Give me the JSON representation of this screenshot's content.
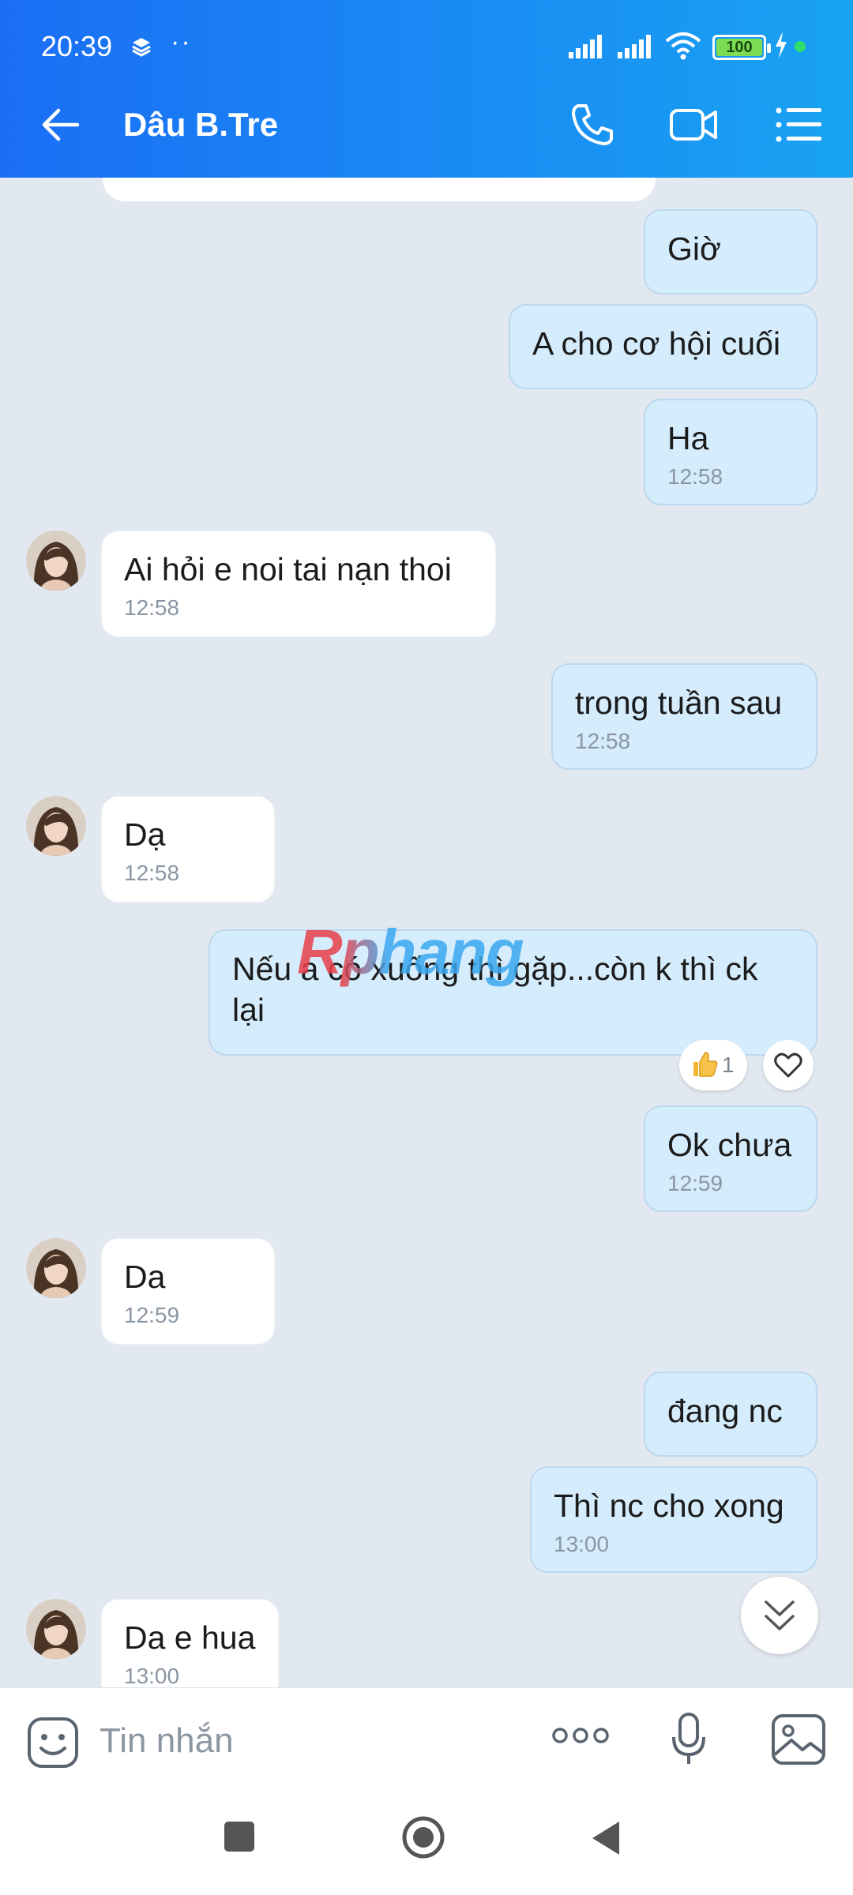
{
  "status_bar": {
    "time": "20:39",
    "dots": "··",
    "battery": "100"
  },
  "header": {
    "title": "Dâu B.Tre"
  },
  "watermark": "Rphang",
  "messages": [
    {
      "side": "out",
      "text": "Giờ",
      "time": ""
    },
    {
      "side": "out",
      "text": "A cho cơ hội cuối",
      "time": ""
    },
    {
      "side": "out",
      "text": "Ha",
      "time": "12:58"
    },
    {
      "side": "in",
      "text": "Ai hỏi e noi tai nạn thoi",
      "time": "12:58"
    },
    {
      "side": "out",
      "text": "trong tuần sau",
      "time": "12:58"
    },
    {
      "side": "in",
      "text": "Dạ",
      "time": "12:58"
    },
    {
      "side": "out",
      "text": "Nếu a có xuống thì gặp...còn k thì ck lại",
      "time": ""
    },
    {
      "side": "out",
      "text": "Ok chưa",
      "time": "12:59"
    },
    {
      "side": "in",
      "text": "Da",
      "time": "12:59"
    },
    {
      "side": "out",
      "text": "đang nc",
      "time": ""
    },
    {
      "side": "out",
      "text": "Thì nc cho xong",
      "time": "13:00"
    },
    {
      "side": "in",
      "text": "Da e hua",
      "time": "13:00"
    }
  ],
  "reaction": {
    "like_count": "1"
  },
  "composer": {
    "placeholder": "Tin nhắn"
  },
  "icons": {
    "back": "arrow-left-icon",
    "call": "phone-icon",
    "video": "video-camera-icon",
    "menu": "list-menu-icon",
    "emoji": "sticker-emoji-icon",
    "more": "more-dots-icon",
    "mic": "microphone-icon",
    "image": "image-gallery-icon",
    "scroll": "double-chevron-down-icon"
  },
  "colors": {
    "header_start": "#1a6ef5",
    "header_end": "#19a3f2",
    "outgoing_bubble": "#d4ecfc",
    "incoming_bubble": "#ffffff",
    "chat_bg": "#e2e8f0"
  }
}
